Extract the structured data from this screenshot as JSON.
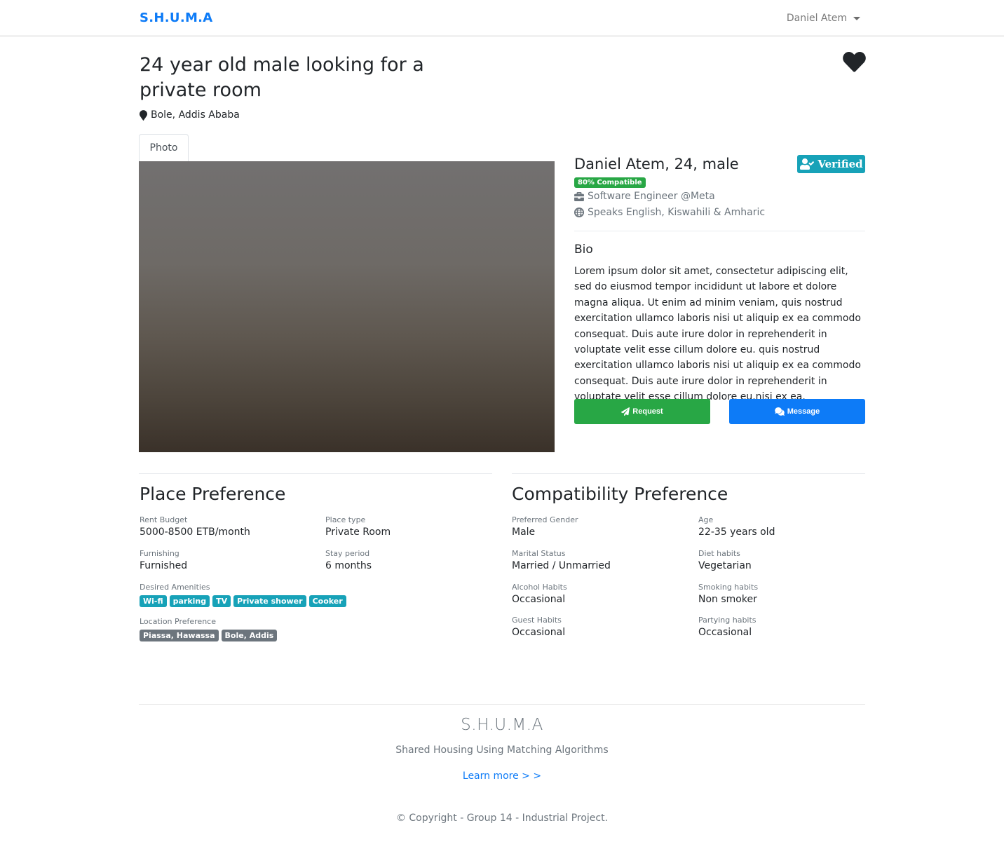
{
  "navbar": {
    "brand": "S.H.U.M.A",
    "user_name": "Daniel Atem"
  },
  "listing": {
    "title": "24 year old male looking for a private room",
    "location": "Bole, Addis Ababa",
    "favorite_icon": "heart-icon",
    "tabs": [
      {
        "label": "Photo",
        "active": true
      }
    ]
  },
  "profile": {
    "name_line": "Daniel Atem, 24, male",
    "verified_label": "Verified",
    "compatibility_label": "80% Compatible",
    "occupation": "Software Engineer @Meta",
    "languages": "Speaks English, Kiswahili & Amharic",
    "bio_heading": "Bio",
    "bio_text": "Lorem ipsum dolor sit amet, consectetur adipiscing elit, sed do eiusmod tempor incididunt ut labore et dolore magna aliqua. Ut enim ad minim veniam, quis nostrud exercitation ullamco laboris nisi ut aliquip ex ea commodo consequat. Duis aute irure dolor in reprehenderit in voluptate velit esse cillum dolore eu. quis nostrud exercitation ullamco laboris nisi ut aliquip ex ea commodo consequat. Duis aute irure dolor in reprehenderit in voluptate velit esse cillum dolore eu.nisi ex ea.",
    "request_label": "Request",
    "message_label": "Message"
  },
  "place_preference": {
    "heading": "Place Preference",
    "fields": [
      {
        "label": "Rent Budget",
        "value": "5000-8500 ETB/month"
      },
      {
        "label": "Place type",
        "value": "Private Room"
      },
      {
        "label": "Furnishing",
        "value": "Furnished"
      },
      {
        "label": "Stay period",
        "value": "6 months"
      }
    ],
    "amenities_label": "Desired Amenities",
    "amenities": [
      "Wi-fi",
      "parking",
      "TV",
      "Private shower",
      "Cooker"
    ],
    "location_label": "Location Preference",
    "locations": [
      "Piassa, Hawassa",
      "Bole, Addis"
    ]
  },
  "compatibility_preference": {
    "heading": "Compatibility Preference",
    "fields": [
      {
        "label": "Preferred Gender",
        "value": "Male"
      },
      {
        "label": "Age",
        "value": "22-35 years old"
      },
      {
        "label": "Marital Status",
        "value": "Married / Unmarried"
      },
      {
        "label": "Diet habits",
        "value": "Vegetarian"
      },
      {
        "label": "Alcohol Habits",
        "value": "Occasional"
      },
      {
        "label": "Smoking habits",
        "value": "Non smoker"
      },
      {
        "label": "Guest Habits",
        "value": "Occasional"
      },
      {
        "label": "Partying habits",
        "value": "Occasional"
      }
    ]
  },
  "footer": {
    "brand": "S.H.U.M.A",
    "tagline": "Shared Housing Using Matching Algorithms",
    "learn_more": "Learn more > >",
    "copyright": "© Copyright - Group 14 - Industrial Project."
  },
  "colors": {
    "primary": "#0d7bf7",
    "success": "#28a745",
    "info": "#17a2b8",
    "secondary": "#6c757d"
  }
}
